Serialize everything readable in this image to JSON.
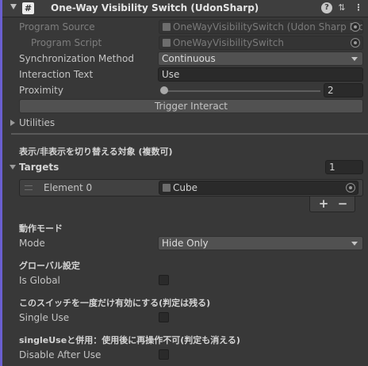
{
  "header": {
    "title": "One-Way Visibility Switch (UdonSharp)",
    "icon_glyph": "#",
    "help_glyph": "?",
    "preset_glyph": "⇅",
    "menu_glyph": "⋮"
  },
  "program": {
    "source_label": "Program Source",
    "source_value": "OneWayVisibilitySwitch (Udon Sharp Pro",
    "script_label": "Program Script",
    "script_value": "OneWayVisibilitySwitch"
  },
  "sync": {
    "label": "Synchronization Method",
    "value": "Continuous"
  },
  "interaction": {
    "label": "Interaction Text",
    "value": "Use"
  },
  "proximity": {
    "label": "Proximity",
    "value": "2",
    "slider_fraction": 0.0
  },
  "trigger_button": "Trigger Interact",
  "utilities_label": "Utilities",
  "targets_section": {
    "heading": "表示/非表示を切り替える対象 (複数可)",
    "label": "Targets",
    "count": "1",
    "elements": [
      {
        "label": "Element 0",
        "value": "Cube"
      }
    ],
    "add_glyph": "+",
    "remove_glyph": "−"
  },
  "mode_section": {
    "heading": "動作モード",
    "label": "Mode",
    "value": "Hide Only"
  },
  "global_section": {
    "heading": "グローバル設定",
    "label": "Is Global",
    "checked": false
  },
  "single_use_section": {
    "heading": "このスイッチを一度だけ有効にする(判定は残る)",
    "label": "Single Use",
    "checked": false
  },
  "disable_section": {
    "heading": "singleUseと併用：使用後に再操作不可(判定も消える)",
    "label": "Disable After Use",
    "checked": false
  },
  "colors": {
    "accent": "#6a5fd0",
    "panel": "#383838",
    "header": "#3e3e3e"
  }
}
